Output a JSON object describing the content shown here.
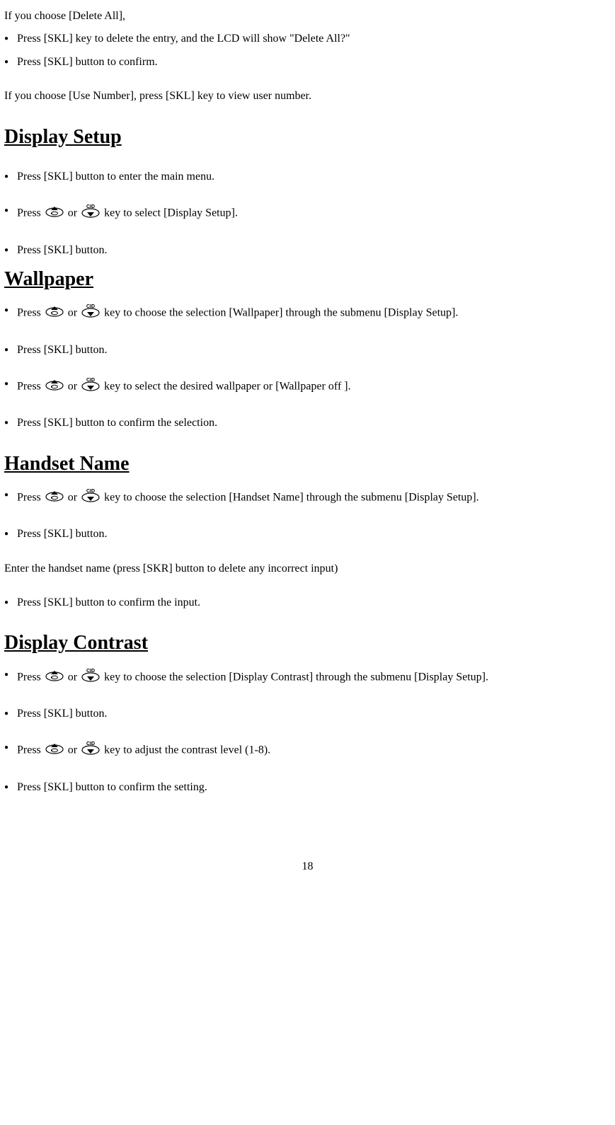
{
  "intro": {
    "deleteAll": "If you choose [Delete All],",
    "bullets": [
      "Press [SKL] key to delete the entry, and the LCD will show \"Delete All?\"",
      "Press [SKL] button to confirm."
    ],
    "useNumber": "If you choose [Use Number], press [SKL] key to view user number."
  },
  "displaySetup": {
    "heading": "Display Setup",
    "b1": "Press [SKL] button to enter the main menu.",
    "b2_pre": "Press ",
    "b2_mid": " or ",
    "b2_post": " key to select [Display Setup].",
    "b3": "Press [SKL] button."
  },
  "wallpaper": {
    "heading": "Wallpaper",
    "b1_pre": "Press ",
    "b1_mid": " or ",
    "b1_post": " key to choose the selection [Wallpaper] through the submenu [Display Setup].",
    "b2": "Press [SKL] button.",
    "b3_pre": "Press ",
    "b3_mid": " or ",
    "b3_post": " key to select the desired wallpaper or [Wallpaper off ].",
    "b4": "Press [SKL] button to confirm the selection."
  },
  "handsetName": {
    "heading": "Handset Name",
    "b1_pre": "Press ",
    "b1_mid": " or ",
    "b1_post": " key to choose the selection [Handset Name] through the submenu [Display Setup].",
    "b2": "Press [SKL] button.",
    "p1": "Enter the handset name (press [SKR] button to delete any incorrect input)",
    "b3": "Press [SKL] button to confirm the input."
  },
  "displayContrast": {
    "heading": "Display Contrast",
    "b1_pre": "Press ",
    "b1_mid": " or ",
    "b1_post": " key to choose the selection [Display Contrast] through the submenu [Display Setup].",
    "b2": "Press [SKL] button.",
    "b3_pre": "Press ",
    "b3_mid": " or ",
    "b3_post": " key to adjust the contrast level (1-8).",
    "b4": "Press [SKL] button to confirm the setting."
  },
  "pageNumber": "18"
}
